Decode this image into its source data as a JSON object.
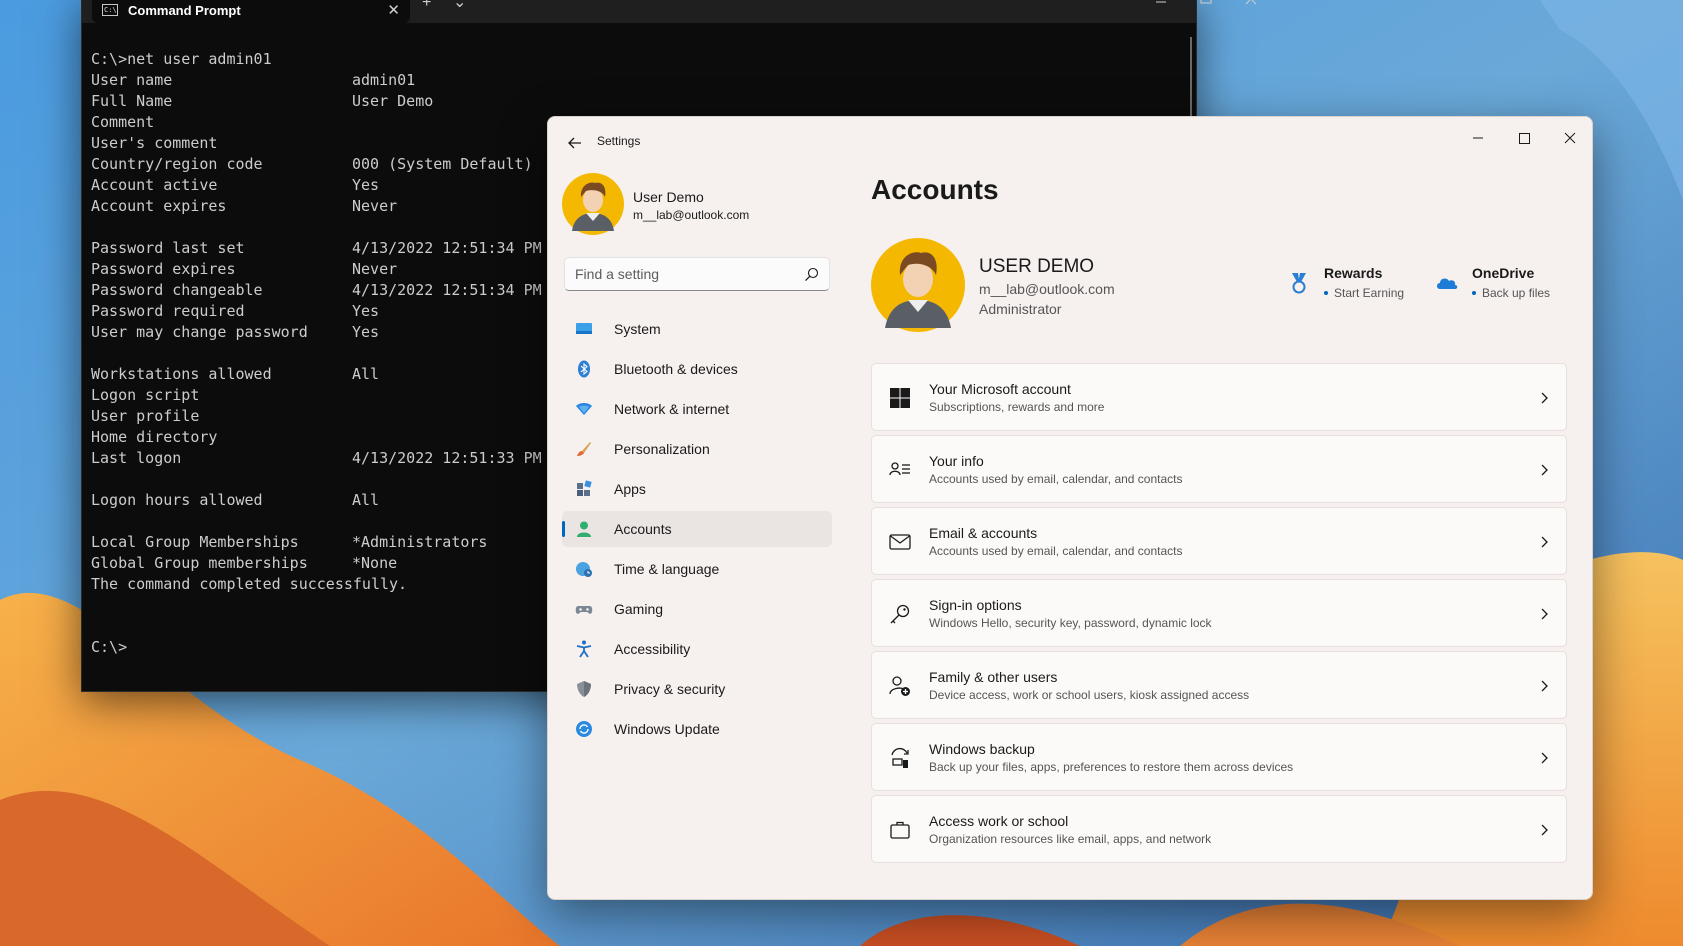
{
  "terminal": {
    "tab_title": "Command Prompt",
    "tab_icon_text": "C:\\",
    "new_tab_glyph": "+",
    "dropdown_glyph": "⌄",
    "lines": [
      {
        "label": "C:\\>net user admin01",
        "value": ""
      },
      {
        "label": "User name",
        "value": "admin01"
      },
      {
        "label": "Full Name",
        "value": "User Demo"
      },
      {
        "label": "Comment",
        "value": ""
      },
      {
        "label": "User's comment",
        "value": ""
      },
      {
        "label": "Country/region code",
        "value": "000 (System Default)"
      },
      {
        "label": "Account active",
        "value": "Yes"
      },
      {
        "label": "Account expires",
        "value": "Never"
      },
      {
        "label": "",
        "value": ""
      },
      {
        "label": "Password last set",
        "value": "4/13/2022 12:51:34 PM"
      },
      {
        "label": "Password expires",
        "value": "Never"
      },
      {
        "label": "Password changeable",
        "value": "4/13/2022 12:51:34 PM"
      },
      {
        "label": "Password required",
        "value": "Yes"
      },
      {
        "label": "User may change password",
        "value": "Yes"
      },
      {
        "label": "",
        "value": ""
      },
      {
        "label": "Workstations allowed",
        "value": "All"
      },
      {
        "label": "Logon script",
        "value": ""
      },
      {
        "label": "User profile",
        "value": ""
      },
      {
        "label": "Home directory",
        "value": ""
      },
      {
        "label": "Last logon",
        "value": "4/13/2022 12:51:33 PM"
      },
      {
        "label": "",
        "value": ""
      },
      {
        "label": "Logon hours allowed",
        "value": "All"
      },
      {
        "label": "",
        "value": ""
      },
      {
        "label": "Local Group Memberships",
        "value": "*Administrators"
      },
      {
        "label": "Global Group memberships",
        "value": "*None"
      },
      {
        "label": "The command completed successfully.",
        "value": ""
      },
      {
        "label": "",
        "value": ""
      },
      {
        "label": "",
        "value": ""
      },
      {
        "label": "C:\\>",
        "value": ""
      }
    ]
  },
  "settings": {
    "window_title": "Settings",
    "nav_profile": {
      "name": "User Demo",
      "email": "m__lab@outlook.com"
    },
    "search": {
      "placeholder": "Find a setting"
    },
    "nav_items": [
      {
        "label": "System",
        "icon": "monitor-icon",
        "selected": false
      },
      {
        "label": "Bluetooth & devices",
        "icon": "bluetooth-icon",
        "selected": false
      },
      {
        "label": "Network & internet",
        "icon": "wifi-icon",
        "selected": false
      },
      {
        "label": "Personalization",
        "icon": "paintbrush-icon",
        "selected": false
      },
      {
        "label": "Apps",
        "icon": "apps-icon",
        "selected": false
      },
      {
        "label": "Accounts",
        "icon": "person-icon",
        "selected": true
      },
      {
        "label": "Time & language",
        "icon": "globe-clock-icon",
        "selected": false
      },
      {
        "label": "Gaming",
        "icon": "gamepad-icon",
        "selected": false
      },
      {
        "label": "Accessibility",
        "icon": "accessibility-icon",
        "selected": false
      },
      {
        "label": "Privacy & security",
        "icon": "shield-icon",
        "selected": false
      },
      {
        "label": "Windows Update",
        "icon": "update-icon",
        "selected": false
      }
    ],
    "page_title": "Accounts",
    "profile": {
      "name": "USER DEMO",
      "email": "m__lab@outlook.com",
      "role": "Administrator"
    },
    "services": [
      {
        "title": "Rewards",
        "subtitle": "Start Earning",
        "icon": "rewards-medal-icon"
      },
      {
        "title": "OneDrive",
        "subtitle": "Back up files",
        "icon": "onedrive-cloud-icon"
      }
    ],
    "cards": [
      {
        "title": "Your Microsoft account",
        "subtitle": "Subscriptions, rewards and more",
        "icon": "windows-logo-icon"
      },
      {
        "title": "Your info",
        "subtitle": "Accounts used by email, calendar, and contacts",
        "icon": "contact-card-icon"
      },
      {
        "title": "Email & accounts",
        "subtitle": "Accounts used by email, calendar, and contacts",
        "icon": "mail-icon"
      },
      {
        "title": "Sign-in options",
        "subtitle": "Windows Hello, security key, password, dynamic lock",
        "icon": "key-icon"
      },
      {
        "title": "Family & other users",
        "subtitle": "Device access, work or school users, kiosk assigned access",
        "icon": "person-add-icon"
      },
      {
        "title": "Windows backup",
        "subtitle": "Back up your files, apps, preferences to restore them across devices",
        "icon": "backup-icon"
      },
      {
        "title": "Access work or school",
        "subtitle": "Organization resources like email, apps, and network",
        "icon": "briefcase-icon"
      }
    ]
  },
  "colors": {
    "accent": "#0067c0",
    "terminal_bg": "#0c0c0c",
    "terminal_text": "#cccccc",
    "settings_bg": "#f6f1ee",
    "avatar_bg": "#f5b800"
  }
}
